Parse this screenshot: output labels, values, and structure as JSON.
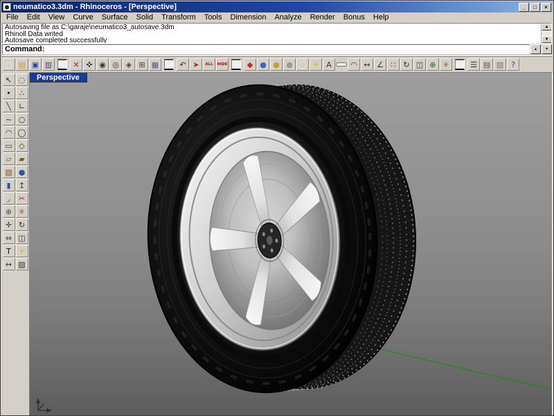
{
  "window": {
    "title": "neumatico3.3dm - Rhinoceros - [Perspective]",
    "minimize": "_",
    "maximize": "□",
    "close": "×"
  },
  "menu": {
    "items": [
      "File",
      "Edit",
      "View",
      "Curve",
      "Surface",
      "Solid",
      "Transform",
      "Tools",
      "Dimension",
      "Analyze",
      "Render",
      "Bonus",
      "Help"
    ]
  },
  "command_history": {
    "lines": [
      "Autosaving file as C:\\garaje\\neumatico3_autosave.3dm",
      "Rhinoll Data writed",
      "Autosave completed successfully"
    ],
    "scroll_up": "▲",
    "scroll_down": "▼"
  },
  "command_line": {
    "prompt": "Command:",
    "value": "",
    "popup_up": "▴",
    "popup_down": "▾"
  },
  "toolbar_top": {
    "icons": [
      {
        "name": "new-file-icon",
        "glyph": "▢",
        "color": "#f8f8f8"
      },
      {
        "name": "open-file-icon",
        "glyph": "▤",
        "color": "#c8a02c"
      },
      {
        "name": "save-icon",
        "glyph": "▣",
        "color": "#23449c"
      },
      {
        "name": "print-icon",
        "glyph": "▥",
        "color": "#4a4a4a"
      },
      {
        "type": "sep"
      },
      {
        "name": "delete-icon",
        "glyph": "✕",
        "color": "#a03030"
      },
      {
        "name": "pan-icon",
        "glyph": "✜",
        "color": "#444444"
      },
      {
        "name": "zoom-in-icon",
        "glyph": "◉",
        "color": "#333333"
      },
      {
        "name": "zoom-out-icon",
        "glyph": "◎",
        "color": "#333333"
      },
      {
        "name": "zoom-window-icon",
        "glyph": "◈",
        "color": "#444444"
      },
      {
        "name": "zoom-extents-icon",
        "glyph": "⊞",
        "color": "#444444"
      },
      {
        "name": "grid-icon",
        "glyph": "▦",
        "color": "#55557a"
      },
      {
        "type": "sep"
      },
      {
        "name": "undo-icon",
        "glyph": "↶",
        "color": "#333333"
      },
      {
        "name": "move-icon",
        "glyph": "➤",
        "color": "#b22222"
      },
      {
        "name": "show-all-button",
        "glyph": "ALL",
        "color": "#cc0000",
        "small": true
      },
      {
        "name": "hide-button",
        "glyph": "HIDE",
        "color": "#cc0000",
        "small": true
      },
      {
        "type": "sep"
      },
      {
        "name": "flamingo-render-icon",
        "glyph": "◆",
        "color": "#cc2222"
      },
      {
        "name": "shaded-view-icon",
        "glyph": "●",
        "color": "#3a62c8"
      },
      {
        "name": "rendered-view-icon",
        "glyph": "●",
        "color": "#c8a018"
      },
      {
        "name": "ghosted-view-icon",
        "glyph": "●",
        "color": "#9a9a9a"
      },
      {
        "name": "wireframe-view-icon",
        "glyph": "◯",
        "color": "#ececec"
      },
      {
        "name": "spotlight-icon",
        "glyph": "☀",
        "color": "#d8b820"
      },
      {
        "name": "material-icon",
        "glyph": "A",
        "color": "#333333"
      },
      {
        "type": "gap"
      },
      {
        "name": "curve-analysis-icon",
        "glyph": "◠",
        "color": "#333333"
      },
      {
        "name": "dimension-icon",
        "glyph": "↔",
        "color": "#333333"
      },
      {
        "name": "angle-icon",
        "glyph": "∠",
        "color": "#333333"
      },
      {
        "name": "array-icon",
        "glyph": "∷",
        "color": "#333333"
      },
      {
        "name": "orient-icon",
        "glyph": "↻",
        "color": "#333333"
      },
      {
        "name": "mirror-icon",
        "glyph": "◫",
        "color": "#333333"
      },
      {
        "name": "join-icon",
        "glyph": "⊕",
        "color": "#2a6a2a"
      },
      {
        "name": "explode-icon",
        "glyph": "✳",
        "color": "#a05a20"
      },
      {
        "type": "sep"
      },
      {
        "name": "layers-icon",
        "glyph": "☰",
        "color": "#333333"
      },
      {
        "name": "properties-icon",
        "glyph": "▤",
        "color": "#555555"
      },
      {
        "name": "notes-icon",
        "glyph": "▧",
        "color": "#777777"
      },
      {
        "name": "help-icon",
        "glyph": "?",
        "color": "#23449c"
      }
    ]
  },
  "toolbar_left": {
    "icons": [
      {
        "name": "select-icon",
        "glyph": "↖",
        "color": "#222222"
      },
      {
        "name": "select-lasso-icon",
        "glyph": "◌",
        "color": "#444444"
      },
      {
        "name": "point-icon",
        "glyph": "•",
        "color": "#222222"
      },
      {
        "name": "points-icon",
        "glyph": "∴",
        "color": "#222222"
      },
      {
        "name": "line-icon",
        "glyph": "╲",
        "color": "#333333"
      },
      {
        "name": "polyline-icon",
        "glyph": "∟",
        "color": "#333333"
      },
      {
        "name": "curve-icon",
        "glyph": "~",
        "color": "#333333"
      },
      {
        "name": "circle-icon",
        "glyph": "○",
        "color": "#333333"
      },
      {
        "name": "arc-icon",
        "glyph": "◠",
        "color": "#333333"
      },
      {
        "name": "ellipse-icon",
        "glyph": "◯",
        "color": "#333333"
      },
      {
        "name": "rectangle-icon",
        "glyph": "▭",
        "color": "#333333"
      },
      {
        "name": "polygon-icon",
        "glyph": "◇",
        "color": "#333333"
      },
      {
        "name": "surface-icon",
        "glyph": "▱",
        "color": "#7a5a2a"
      },
      {
        "name": "plane-icon",
        "glyph": "▰",
        "color": "#7a5a2a"
      },
      {
        "name": "box-icon",
        "glyph": "▧",
        "color": "#7a5a2a"
      },
      {
        "name": "sphere-icon",
        "glyph": "●",
        "color": "#33559a"
      },
      {
        "name": "cylinder-icon",
        "glyph": "▮",
        "color": "#33559a"
      },
      {
        "name": "extrude-icon",
        "glyph": "↥",
        "color": "#333333"
      },
      {
        "name": "fillet-icon",
        "glyph": "◞",
        "color": "#333333"
      },
      {
        "name": "trim-icon",
        "glyph": "✂",
        "color": "#a03030"
      },
      {
        "name": "join-curves-icon",
        "glyph": "⊕",
        "color": "#2a6a2a"
      },
      {
        "name": "explode-curves-icon",
        "glyph": "✳",
        "color": "#a05a20"
      },
      {
        "name": "move-object-icon",
        "glyph": "✛",
        "color": "#333333"
      },
      {
        "name": "rotate-object-icon",
        "glyph": "↻",
        "color": "#333333"
      },
      {
        "name": "scale-icon",
        "glyph": "⇔",
        "color": "#333333"
      },
      {
        "name": "mirror-object-icon",
        "glyph": "◫",
        "color": "#333333"
      },
      {
        "name": "text-icon",
        "glyph": "T",
        "color": "#111111"
      },
      {
        "name": "bonus-tools-icon",
        "glyph": "⚡",
        "color": "#d8a800"
      },
      {
        "name": "dimension-tool-icon",
        "glyph": "↔",
        "color": "#333333"
      },
      {
        "name": "hatch-icon",
        "glyph": "▨",
        "color": "#333333"
      }
    ]
  },
  "viewport": {
    "label": "Perspective",
    "background_top": "#9e9e9e",
    "background_bottom": "#5c5c5c",
    "axis_y_color": "#1e8a1e"
  }
}
